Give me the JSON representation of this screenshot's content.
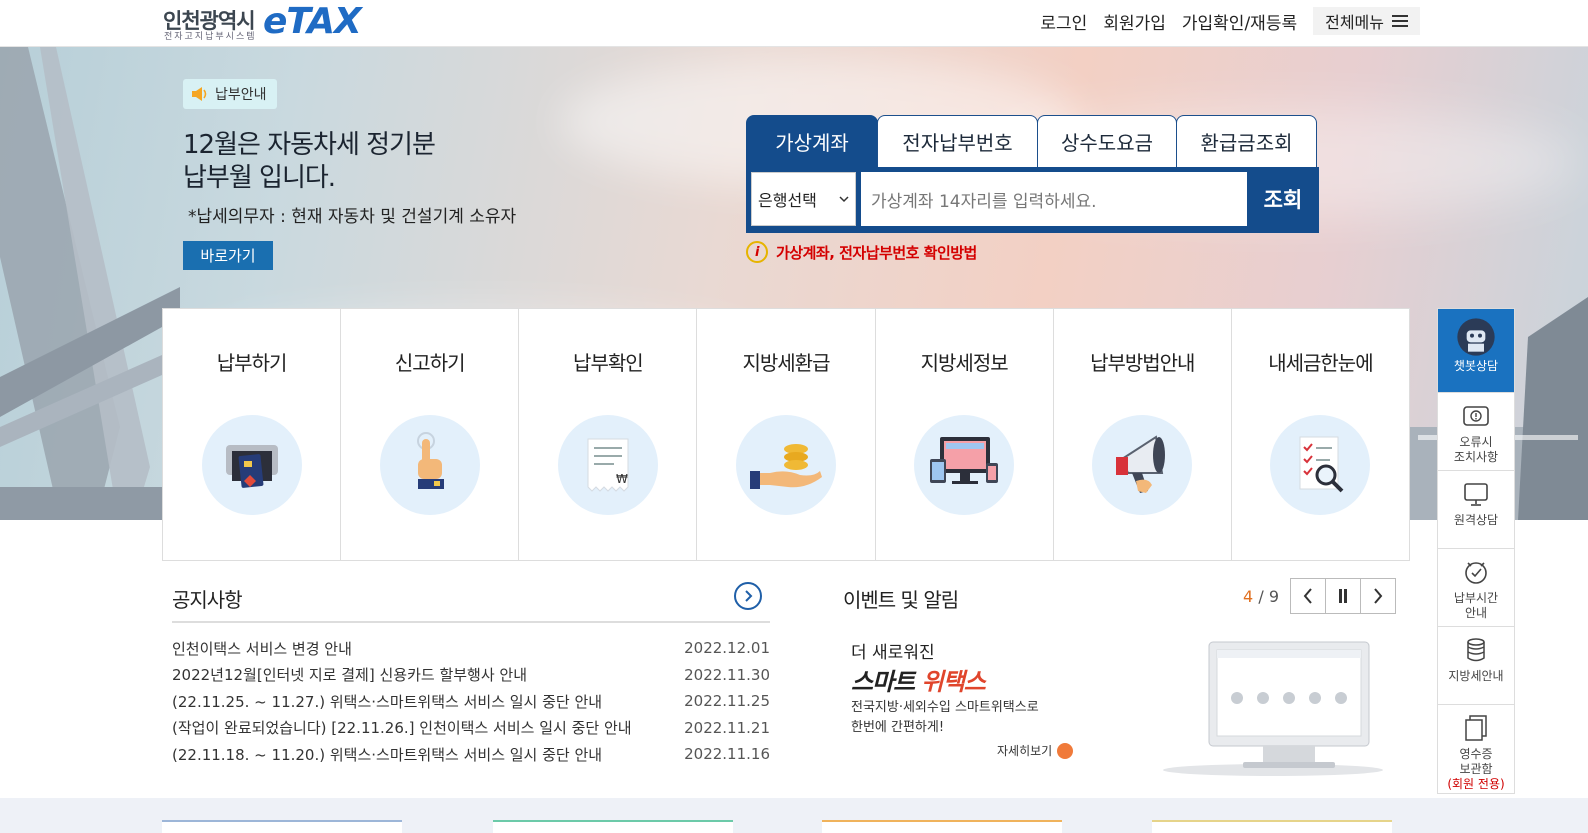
{
  "header": {
    "logo_kr": "인천광역시",
    "logo_sub": "전자고지납부시스템",
    "logo_etax": "eTAX",
    "nav": [
      "로그인",
      "회원가입",
      "가입확인/재등록"
    ],
    "menu_label": "전체메뉴"
  },
  "hero": {
    "badge": "납부안내",
    "title_line1": "12월은 자동차세 정기분",
    "title_line2": "납부월 입니다.",
    "subtitle": "*납세의무자 : 현재 자동차 및 건설기계 소유자",
    "go_button": "바로가기"
  },
  "search": {
    "tabs": [
      "가상계좌",
      "전자납부번호",
      "상수도요금",
      "환급금조회"
    ],
    "bank_select": "은행선택",
    "placeholder": "가상계좌 14자리를 입력하세요.",
    "button": "조회",
    "info": "가상계좌, 전자납부번호 확인방법"
  },
  "services": [
    {
      "label": "납부하기",
      "icon": "atm-card-icon"
    },
    {
      "label": "신고하기",
      "icon": "hand-pointer-icon"
    },
    {
      "label": "납부확인",
      "icon": "receipt-icon"
    },
    {
      "label": "지방세환급",
      "icon": "coins-hand-icon"
    },
    {
      "label": "지방세정보",
      "icon": "devices-icon"
    },
    {
      "label": "납부방법안내",
      "icon": "megaphone-icon"
    },
    {
      "label": "내세금한눈에",
      "icon": "checklist-magnifier-icon"
    }
  ],
  "notice": {
    "title": "공지사항",
    "items": [
      {
        "title": "인천이택스 서비스 변경 안내",
        "date": "2022.12.01"
      },
      {
        "title": "2022년12월[인터넷 지로 결제] 신용카드 할부행사 안내",
        "date": "2022.11.30"
      },
      {
        "title": "(22.11.25. ~ 11.27.) 위택스·스마트위택스 서비스 일시 중단 안내",
        "date": "2022.11.25"
      },
      {
        "title": "(작업이 완료되었습니다) [22.11.26.] 인천이택스 서비스 일시 중단 안내",
        "date": "2022.11.21"
      },
      {
        "title": "(22.11.18. ~ 11.20.) 위택스·스마트위택스 서비스 일시 중단 안내",
        "date": "2022.11.16"
      }
    ]
  },
  "events": {
    "title": "이벤트 및 알림",
    "current": "4",
    "separator": "/",
    "total": "9",
    "banner_line1": "더 새로워진",
    "banner_line2a": "스마트 ",
    "banner_line2b": "위택스",
    "banner_desc1": "전국지방·세외수입 스마트위택스로",
    "banner_desc2": "한번에 간편하게!",
    "banner_more": "자세히보기"
  },
  "quickbar": [
    {
      "lines": [
        "챗봇상담"
      ],
      "icon": "chatbot-icon"
    },
    {
      "lines": [
        "오류시",
        "조치사항"
      ],
      "icon": "alert-icon"
    },
    {
      "lines": [
        "원격상담"
      ],
      "icon": "monitor-icon"
    },
    {
      "lines": [
        "납부시간",
        "안내"
      ],
      "icon": "clock-icon"
    },
    {
      "lines": [
        "지방세안내"
      ],
      "icon": "coin-stack-icon"
    },
    {
      "lines": [
        "영수증",
        "보관함",
        "(회원 전용)"
      ],
      "icon": "documents-icon"
    }
  ],
  "colors": {
    "primary": "#144c8c",
    "accent_blue": "#1a72c0",
    "alert_red": "#d40000",
    "orange": "#e07020"
  }
}
